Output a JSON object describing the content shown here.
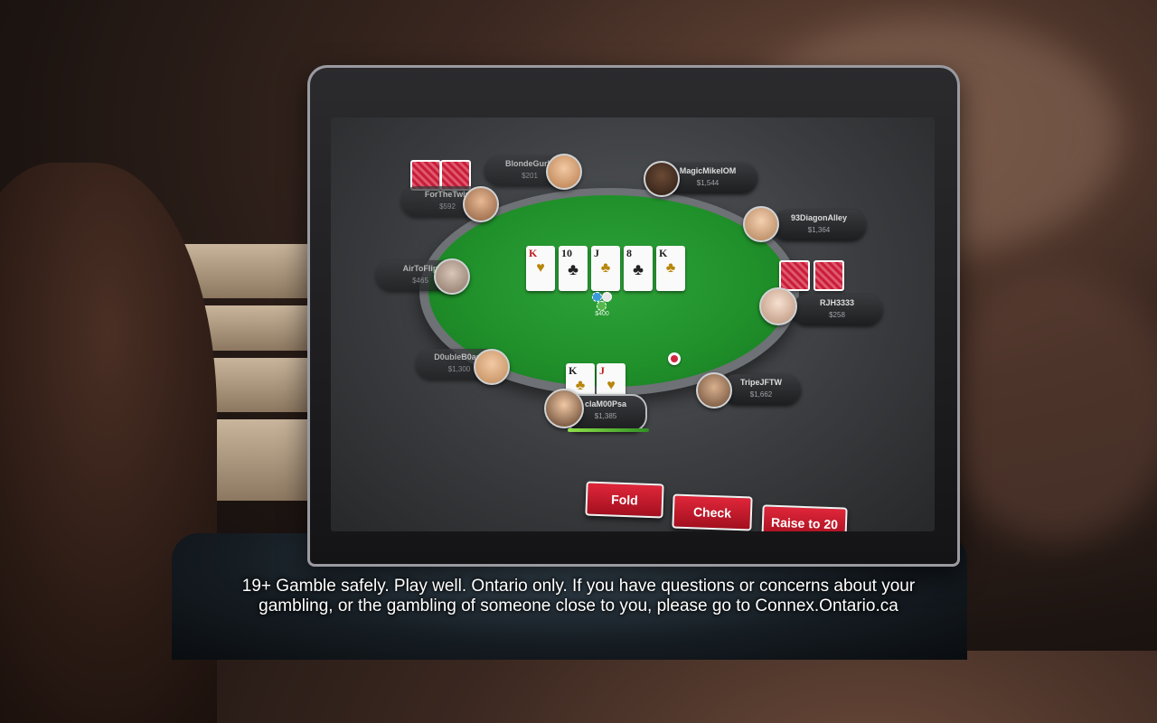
{
  "table": {
    "community_cards": [
      {
        "rank": "K",
        "suit": "♥",
        "color": "red",
        "face": true
      },
      {
        "rank": "10",
        "suit": "♣",
        "color": "black",
        "face": false
      },
      {
        "rank": "J",
        "suit": "♣",
        "color": "black",
        "face": true
      },
      {
        "rank": "8",
        "suit": "♣",
        "color": "black",
        "face": false
      },
      {
        "rank": "K",
        "suit": "♣",
        "color": "black",
        "face": true
      }
    ],
    "pot": "$400",
    "hero_cards": [
      {
        "rank": "K",
        "suit": "♣",
        "color": "black",
        "face": true
      },
      {
        "rank": "J",
        "suit": "♥",
        "color": "red",
        "face": true
      }
    ]
  },
  "players": [
    {
      "name": "BlondeGurly",
      "stack": "$201"
    },
    {
      "name": "MagicMikeIOM",
      "stack": "$1,544"
    },
    {
      "name": "ForTheTwin",
      "stack": "$592"
    },
    {
      "name": "93DiagonAlley",
      "stack": "$1,364"
    },
    {
      "name": "AirToFlip",
      "stack": "$465"
    },
    {
      "name": "RJH3333",
      "stack": "$258"
    },
    {
      "name": "D0ubleB0ard",
      "stack": "$1,300"
    },
    {
      "name": "TripeJFTW",
      "stack": "$1,662"
    },
    {
      "name": "claM00Psa",
      "stack": "$1,385"
    }
  ],
  "actions": {
    "fold": "Fold",
    "check": "Check",
    "raise": "Raise to 20"
  },
  "disclaimer": {
    "line1": "19+ Gamble safely. Play well. Ontario only. If you have questions or concerns about your",
    "line2": "gambling, or the gambling of someone close to you, please go to Connex.Ontario.ca"
  },
  "colors": {
    "felt": "#1f8f2a",
    "button_red": "#c8182b",
    "card_back": "#c91f3a"
  }
}
